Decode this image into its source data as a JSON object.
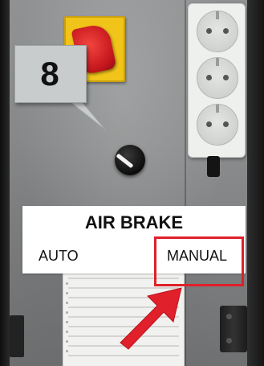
{
  "callout": {
    "number": "8"
  },
  "label": {
    "title": "AIR BRAKE",
    "left_option": "AUTO",
    "right_option": "MANUAL"
  },
  "highlight": {
    "target": "MANUAL",
    "color": "#e0202a"
  },
  "arrow": {
    "color": "#e0202a",
    "icon": "arrow-pointing-up-right-icon"
  },
  "colors": {
    "main_switch_base": "#f0c419",
    "main_switch_knob": "#c4161c",
    "panel": "#8a8c8d",
    "socket_strip": "#eef0ee"
  }
}
